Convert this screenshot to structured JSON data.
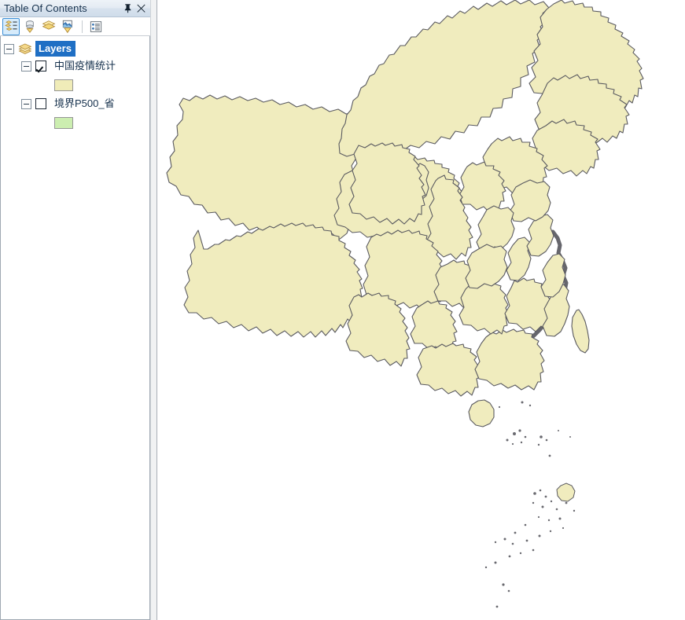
{
  "panel": {
    "title": "Table Of Contents",
    "titlebar_buttons": [
      {
        "name": "auto-hide-pin-button",
        "icon": "pin-icon",
        "tooltip": "Auto Hide"
      },
      {
        "name": "close-button",
        "icon": "close-icon",
        "tooltip": "Close"
      }
    ],
    "toolbar": {
      "buttons": [
        {
          "name": "list-by-drawing-order-button",
          "icon": "list-by-drawing-order-icon",
          "label": "List By Drawing Order",
          "selected": true
        },
        {
          "name": "list-by-source-button",
          "icon": "list-by-source-icon",
          "label": "List By Source",
          "selected": false
        },
        {
          "name": "list-by-visibility-button",
          "icon": "list-by-visibility-icon",
          "label": "List By Visibility",
          "selected": false
        },
        {
          "name": "list-by-selection-button",
          "icon": "list-by-selection-icon",
          "label": "List By Selection",
          "selected": false
        },
        {
          "name": "options-button",
          "icon": "options-icon",
          "label": "Options",
          "selected": false
        }
      ]
    },
    "tree": {
      "root": {
        "label": "Layers",
        "icon": "layers-stack-icon",
        "selected": true,
        "expanded": true
      },
      "layers": [
        {
          "label": "中国疫情统计",
          "checked": true,
          "expanded": true,
          "symbol": {
            "fill": "#F0ECB8",
            "outline": "#969696"
          }
        },
        {
          "label": "境界P500_省",
          "checked": false,
          "expanded": true,
          "symbol": {
            "fill": "#CCEEB0",
            "outline": "#969696"
          }
        }
      ]
    }
  },
  "map": {
    "background": "#FFFFFF",
    "land_fill": "#F0ECBE",
    "boundary_stroke": "#5A5A60",
    "coast_shadow": "#5A5A60",
    "region_name": "China",
    "features": [
      "mainland-provinces",
      "taiwan-island",
      "hainan-island",
      "south-china-sea-islands"
    ]
  },
  "colors": {
    "selection_blue": "#1F6FC4",
    "toolbar_selected_border": "#3C8FD6",
    "title_text": "#16314D",
    "panel_border": "#9FA8B2"
  }
}
